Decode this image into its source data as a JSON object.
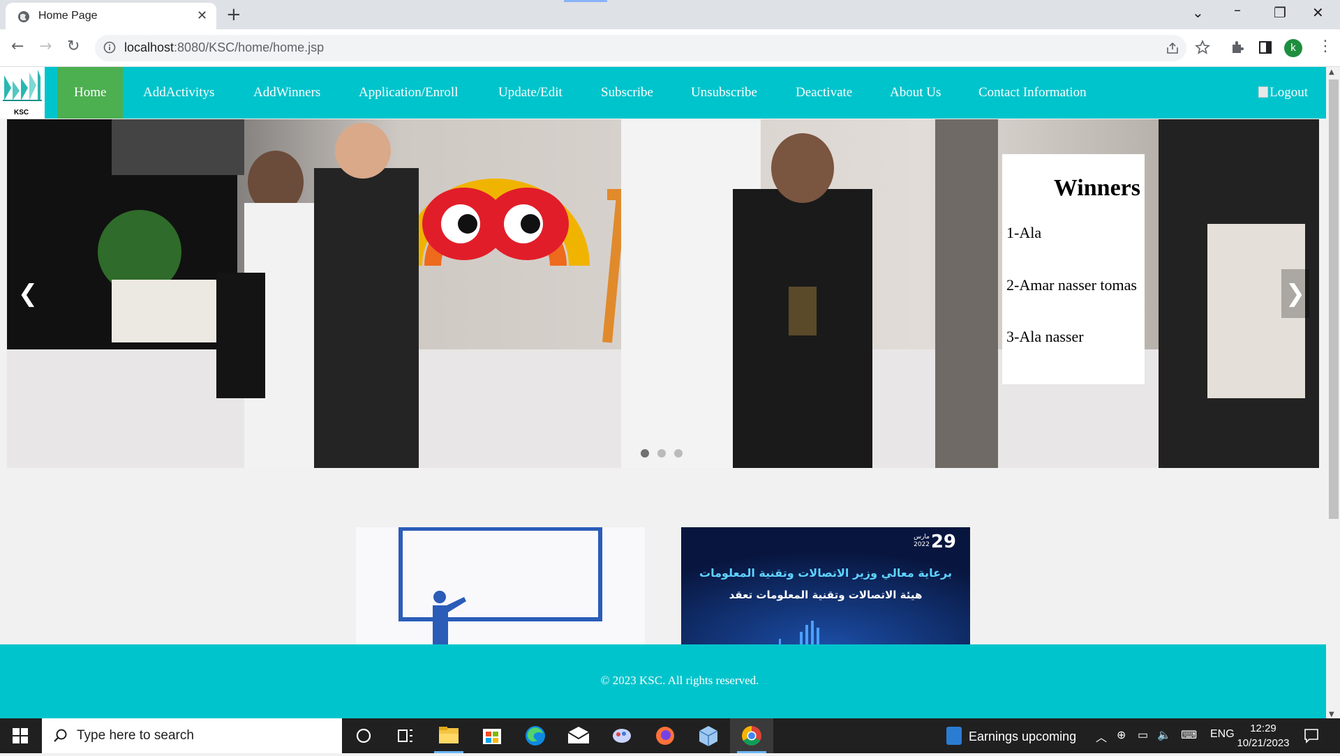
{
  "browser": {
    "tab_title": "Home Page",
    "url_host": "localhost",
    "url_rest": ":8080/KSC/home/home.jsp",
    "profile_initial": "k"
  },
  "site": {
    "logo_text": "KSC",
    "nav": {
      "items": [
        "Home",
        "AddActivitys",
        "AddWinners",
        "Application/Enroll",
        "Update/Edit",
        "Subscribe",
        "Unsubscribe",
        "Deactivate",
        "About Us",
        "Contact Information"
      ],
      "active": "Home",
      "logout": "Logout"
    },
    "carousel": {
      "winners_title": "Winners",
      "winners": [
        "1-Ala",
        "2-Amar nasser tomas",
        "3-Ala nasser"
      ],
      "prev": "❮",
      "next": "❯",
      "slide_count": 3,
      "active_slide": 1
    },
    "cards": {
      "card2_date_day": "29",
      "card2_date_year": "2022",
      "card2_date_month": "مارس",
      "card2_line1": "برعاية معالي وزير الاتصالات وتقنية المعلومات",
      "card2_line2": "هيئة الاتصالات  وتقنية المعلومات تعقد"
    },
    "footer": "© 2023 KSC. All rights reserved."
  },
  "taskbar": {
    "search_placeholder": "Type here to search",
    "news": "Earnings upcoming",
    "lang": "ENG",
    "time": "12:29",
    "date": "10/21/2023"
  },
  "colors": {
    "nav_bg": "#00c4cc",
    "active_bg": "#4caf50",
    "footer_bg": "#00c4cc"
  }
}
